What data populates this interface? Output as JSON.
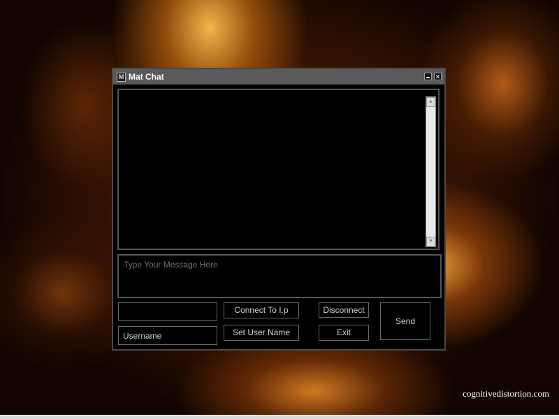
{
  "window": {
    "title": "Mat Chat",
    "icon": "app-icon",
    "minimize_icon": "minimize-icon",
    "close_symbol": "✕"
  },
  "chat_log": {
    "content": ""
  },
  "message_box": {
    "placeholder": "Type Your Message Here"
  },
  "ip_field": {
    "value": ""
  },
  "username_field": {
    "placeholder": "Username"
  },
  "buttons": {
    "connect": "Connect To I.p",
    "set_user_name": "Set User Name",
    "disconnect": "Disconnect",
    "exit": "Exit",
    "send": "Send"
  },
  "desktop": {
    "credit": "cognitivedistortion.com"
  },
  "colors": {
    "window_bg": "#000000",
    "titlebar": "#5a5a5a",
    "border": "#6a6a6a",
    "text": "#d0d0d0"
  }
}
